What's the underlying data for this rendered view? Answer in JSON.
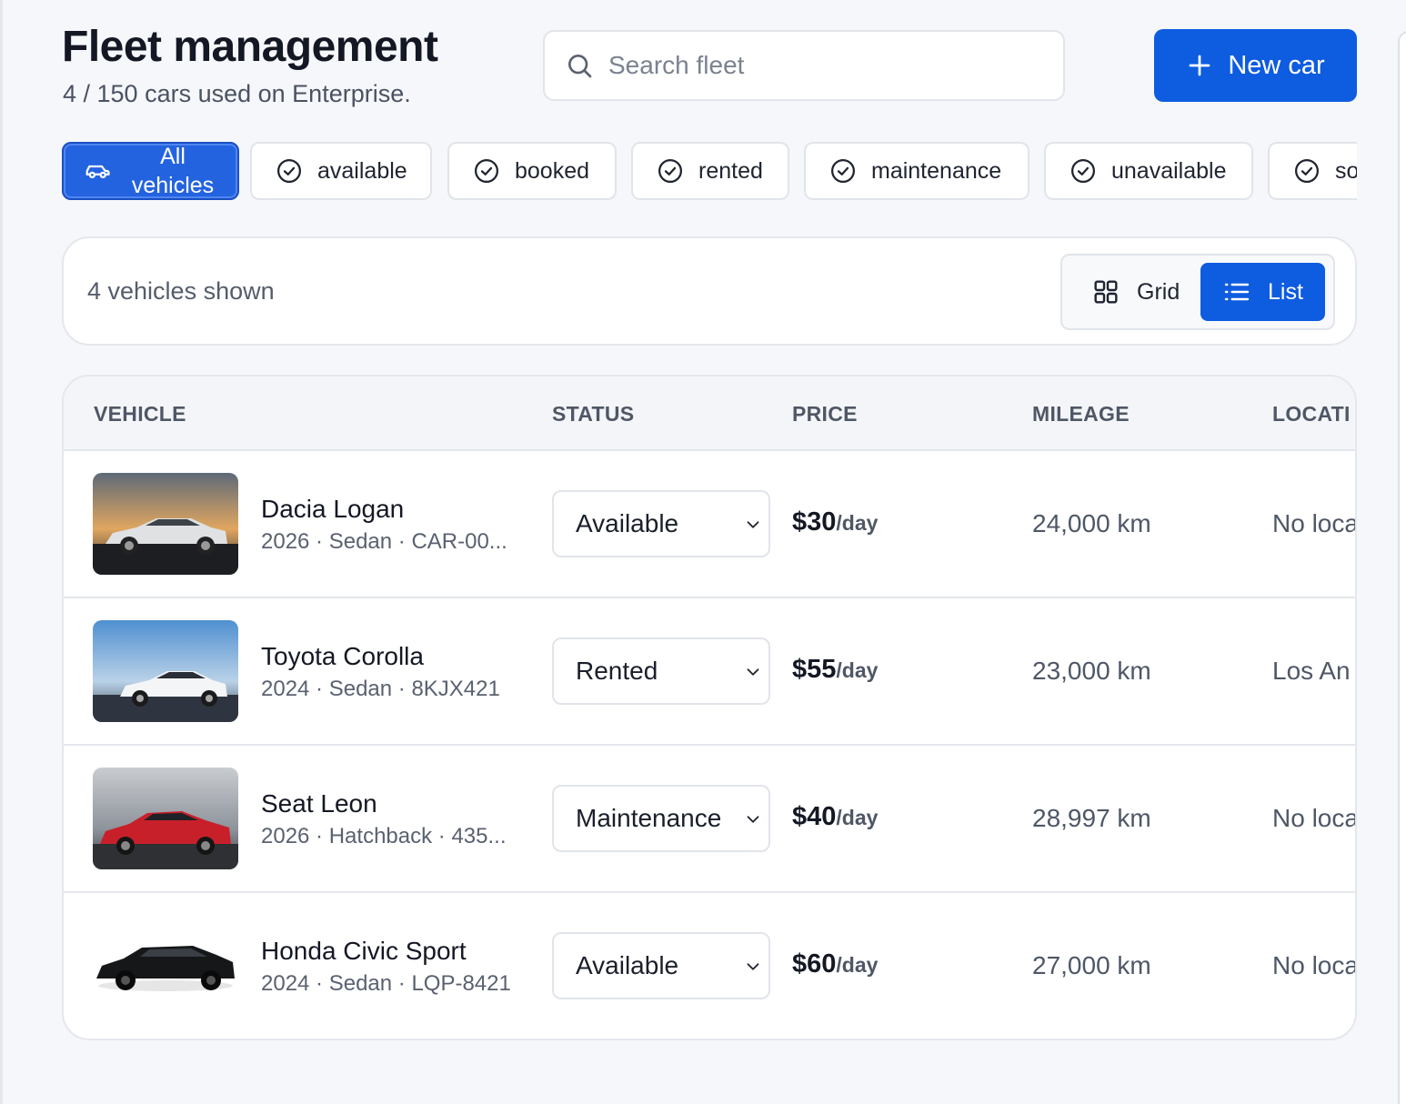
{
  "header": {
    "title": "Fleet management",
    "subtitle": "4 / 150 cars used on Enterprise.",
    "search_placeholder": "Search fleet",
    "new_car_label": "New car"
  },
  "filters": {
    "all_label": "All vehicles",
    "chips": [
      "available",
      "booked",
      "rented",
      "maintenance",
      "unavailable",
      "so"
    ]
  },
  "toolbar": {
    "count_text": "4 vehicles shown",
    "grid_label": "Grid",
    "list_label": "List",
    "active_view": "List"
  },
  "table": {
    "columns": [
      "VEHICLE",
      "STATUS",
      "PRICE",
      "MILEAGE",
      "LOCATI"
    ],
    "rows": [
      {
        "name": "Dacia Logan",
        "meta": "2026 · Sedan · CAR-00...",
        "status": "Available",
        "price": "$30",
        "price_unit": "/day",
        "mileage": "24,000 km",
        "location": "No loca"
      },
      {
        "name": "Toyota Corolla",
        "meta": "2024 · Sedan · 8KJX421",
        "status": "Rented",
        "price": "$55",
        "price_unit": "/day",
        "mileage": "23,000 km",
        "location": "Los An"
      },
      {
        "name": "Seat Leon",
        "meta": "2026 · Hatchback · 435...",
        "status": "Maintenance",
        "price": "$40",
        "price_unit": "/day",
        "mileage": "28,997 km",
        "location": "No loca"
      },
      {
        "name": "Honda Civic Sport",
        "meta": "2024 · Sedan · LQP-8421",
        "status": "Available",
        "price": "$60",
        "price_unit": "/day",
        "mileage": "27,000 km",
        "location": "No loca"
      }
    ]
  },
  "colors": {
    "primary": "#0e5ce0",
    "chip_active": "#2463e0",
    "border": "#e1e4ea",
    "page_bg": "#f6f7fa"
  }
}
